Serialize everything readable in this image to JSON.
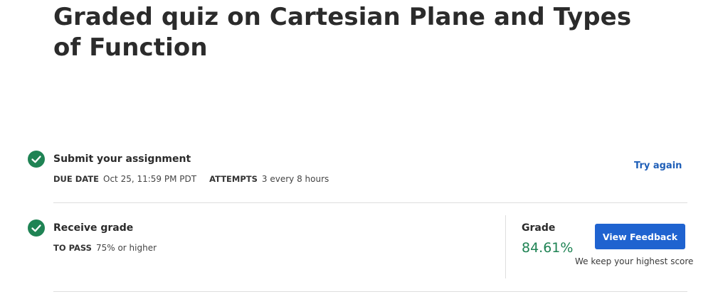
{
  "page": {
    "title": "Graded quiz on Cartesian Plane and Types of Function"
  },
  "submit": {
    "title": "Submit your assignment",
    "due_label": "DUE DATE",
    "due_value": "Oct 25, 11:59 PM PDT",
    "attempts_label": "ATTEMPTS",
    "attempts_value": "3 every 8 hours",
    "try_again": "Try again",
    "icon": "check-circle-icon"
  },
  "receive": {
    "title": "Receive grade",
    "pass_label": "TO PASS",
    "pass_value": "75% or higher",
    "icon": "check-circle-icon"
  },
  "grade": {
    "label": "Grade",
    "value": "84.61%",
    "button": "View Feedback",
    "note": "We keep your highest score"
  },
  "colors": {
    "success": "#1f8354",
    "primary": "#1f63d0",
    "link": "#1f5fb8"
  }
}
